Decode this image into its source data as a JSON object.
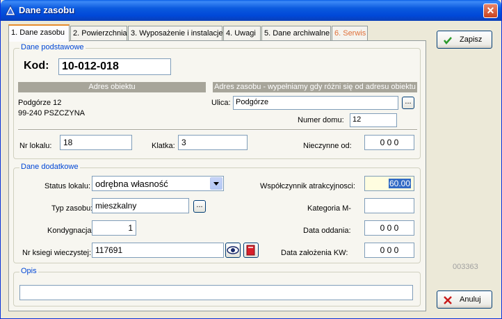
{
  "window": {
    "title": "Dane zasobu"
  },
  "tabs": [
    {
      "label": "1. Dane zasobu",
      "state": "active"
    },
    {
      "label": "2. Powierzchnia",
      "state": "normal"
    },
    {
      "label": "3. Wyposażenie i instalacje",
      "state": "normal"
    },
    {
      "label": "4. Uwagi",
      "state": "normal"
    },
    {
      "label": "5. Dane archiwalne",
      "state": "normal"
    },
    {
      "label": "6. Serwis",
      "state": "disabled"
    }
  ],
  "basic": {
    "group_label": "Dane podstawowe",
    "kod_label": "Kod:",
    "kod_value": "10-012-018",
    "address_header": "Adres obiektu",
    "address_line1": "Podgórze 12",
    "address_line2": "99-240 PSZCZYNA",
    "resource_address_header": "Adres zasobu - wypełniamy gdy różni się od adresu obiektu",
    "ulica_label": "Ulica:",
    "ulica_value": "Podgórze",
    "numer_domu_label": "Numer domu:",
    "numer_domu_value": "12",
    "nr_lokalu_label": "Nr lokalu:",
    "nr_lokalu_value": "18",
    "klatka_label": "Klatka:",
    "klatka_value": "3",
    "nieczynne_label": "Nieczynne od:",
    "nieczynne_value": "0 0 0"
  },
  "extra": {
    "group_label": "Dane dodatkowe",
    "status_label": "Status lokalu:",
    "status_value": "odrębna własność",
    "typ_label": "Typ zasobu:",
    "typ_value": "mieszkalny",
    "kondygnacja_label": "Kondygnacja:",
    "kondygnacja_value": "1",
    "ksiega_label": "Nr ksiegi wieczystej:",
    "ksiega_value": "117691",
    "wspolczynnik_label": "Współczynnik atrakcyjnosci:",
    "wspolczynnik_value": "60.00",
    "kategoria_label": "Kategoria M-",
    "kategoria_value": "",
    "data_oddania_label": "Data oddania:",
    "data_oddania_value": "0 0 0",
    "data_kw_label": "Data założenia KW:",
    "data_kw_value": "0 0 0"
  },
  "opis": {
    "group_label": "Opis",
    "value": ""
  },
  "buttons": {
    "save_label": "Zapisz",
    "cancel_label": "Anuluj",
    "browse_label": "..."
  },
  "record_id": "003363",
  "colors": {
    "title_bar": "#0054e3",
    "group_label": "#0046d5",
    "disabled_tab": "#e0703a",
    "selection": "#316ac5"
  }
}
